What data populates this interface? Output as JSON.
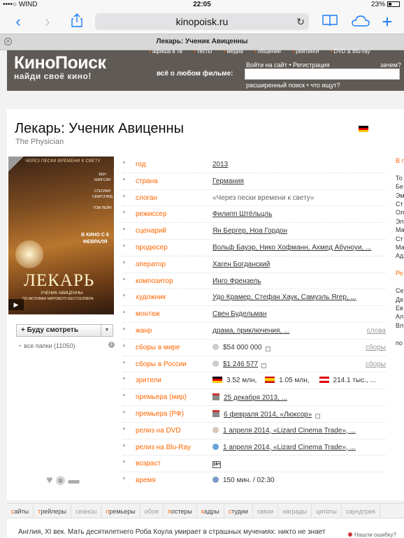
{
  "status_bar": {
    "carrier": "••••○ WIND",
    "time": "22:05",
    "battery": "23%"
  },
  "browser": {
    "url": "kinopoisk.ru",
    "tab_title": "Лекарь: Ученик Авиценны"
  },
  "site_header": {
    "logo": "КиноПоиск",
    "tagline": "найди своё кино!",
    "top_menu": [
      "афиша в тв",
      "тесты",
      "медиа",
      "общение",
      "рейтинги",
      "DVD & Blu-ray"
    ],
    "search_label": "всё о любом фильме:",
    "login_text": "Войти на сайт • Регистрация",
    "what_next": "зачем?",
    "search_links": "расширенный поиск • что ищут?"
  },
  "movie": {
    "title": "Лекарь: Ученик Авиценны",
    "original_title": "The Physician",
    "poster": {
      "tagline": "ЧЕРЕЗ ПЕСКИ ВРЕМЕНИ К СВЕТУ",
      "cast": "БЕН КИНГСЛИ\n\nСТЕЛЛАН СКАРСГАРД\n\nТОМ ПЕЙН",
      "release": "В КИНО С 6 ФЕВРАЛЯ",
      "title": "ЛЕКАРЬ",
      "subtitle": "УЧЕНИК АВИЦЕННЫ",
      "based_on": "ПО МОТИВАМ МИРОВОГО БЕСТСЕЛЛЕРА"
    },
    "watch_button": "+ Буду смотреть",
    "folders": "все папки (11050)"
  },
  "info_rows": {
    "year": {
      "label": "год",
      "value": "2013"
    },
    "country": {
      "label": "страна",
      "value": "Германия"
    },
    "slogan": {
      "label": "слоган",
      "value": "«Через пески времени к свету»"
    },
    "director": {
      "label": "режиссер",
      "value": "Филипп Штёльцль"
    },
    "writer": {
      "label": "сценарий",
      "value": "Ян Бергер, Ноа Гордон"
    },
    "producer": {
      "label": "продюсер",
      "value": "Вольф Бауэр, Нико Хофманн, Ахмед Абуноуи, ..."
    },
    "operator": {
      "label": "оператор",
      "value": "Хаген Богданский"
    },
    "composer": {
      "label": "композитор",
      "value": "Инго Френзель"
    },
    "artist": {
      "label": "художник",
      "value": "Удо Крамер, Стефан Хаук, Самуэль Ягер, ..."
    },
    "editing": {
      "label": "монтаж",
      "value": "Свен Будельман"
    },
    "genre": {
      "label": "жанр",
      "value": "драма, приключения, ...",
      "right": "слова"
    },
    "box_world": {
      "label": "сборы в мире",
      "value": "$54 000 000",
      "right": "сборы"
    },
    "box_russia": {
      "label": "сборы в России",
      "value": "$1 246 577",
      "right": "сборы"
    },
    "viewers": {
      "label": "зрители",
      "de": "3.52 млн,",
      "es": "1.05 млн,",
      "at": "214.1 тыс., ..."
    },
    "premiere_world": {
      "label": "премьера (мир)",
      "value": "25 декабря 2013, ..."
    },
    "premiere_rf": {
      "label": "премьера (РФ)",
      "value": "6 февраля 2014, «Люксор»"
    },
    "dvd": {
      "label": "релиз на DVD",
      "value": "1 апреля 2014, «Lizard Cinema Trade», ..."
    },
    "bluray": {
      "label": "релиз на Blu-Ray",
      "value": "1 апреля 2014, «Lizard Cinema Trade», ..."
    },
    "age": {
      "label": "возраст",
      "value": "16+"
    },
    "duration": {
      "label": "время",
      "value": "150 мин. / 02:30"
    }
  },
  "right_column": [
    "В г",
    "",
    "То",
    "Бе",
    "Эм",
    "Ст",
    "Ол",
    "Эл",
    "Ма",
    "Ст",
    "Ма",
    "Ад",
    "",
    "Ро",
    "",
    "Се",
    "Де",
    "Ев",
    "Ал",
    "Вл",
    "",
    "по"
  ],
  "bottom_tabs": [
    {
      "label": "сайты",
      "active": true
    },
    {
      "label": "трейлеры",
      "active": true
    },
    {
      "label": "сеансы",
      "active": false
    },
    {
      "label": "премьеры",
      "active": true
    },
    {
      "label": "обои",
      "active": false
    },
    {
      "label": "постеры",
      "active": true
    },
    {
      "label": "кадры",
      "active": true
    },
    {
      "label": "студии",
      "active": true
    },
    {
      "label": "связи",
      "active": false
    },
    {
      "label": "награды",
      "active": false
    },
    {
      "label": "цитаты",
      "active": false
    },
    {
      "label": "саундтрек",
      "active": false
    }
  ],
  "description": "Англия, XI век. Мать десятилетнего Роба Коула умирает в страшных мучениях: никто не знает",
  "report_error": "Нашли ошибку?",
  "colors": {
    "accent": "#ff6600",
    "header": "#5f5a55",
    "ios_blue": "#1a7cf5"
  }
}
